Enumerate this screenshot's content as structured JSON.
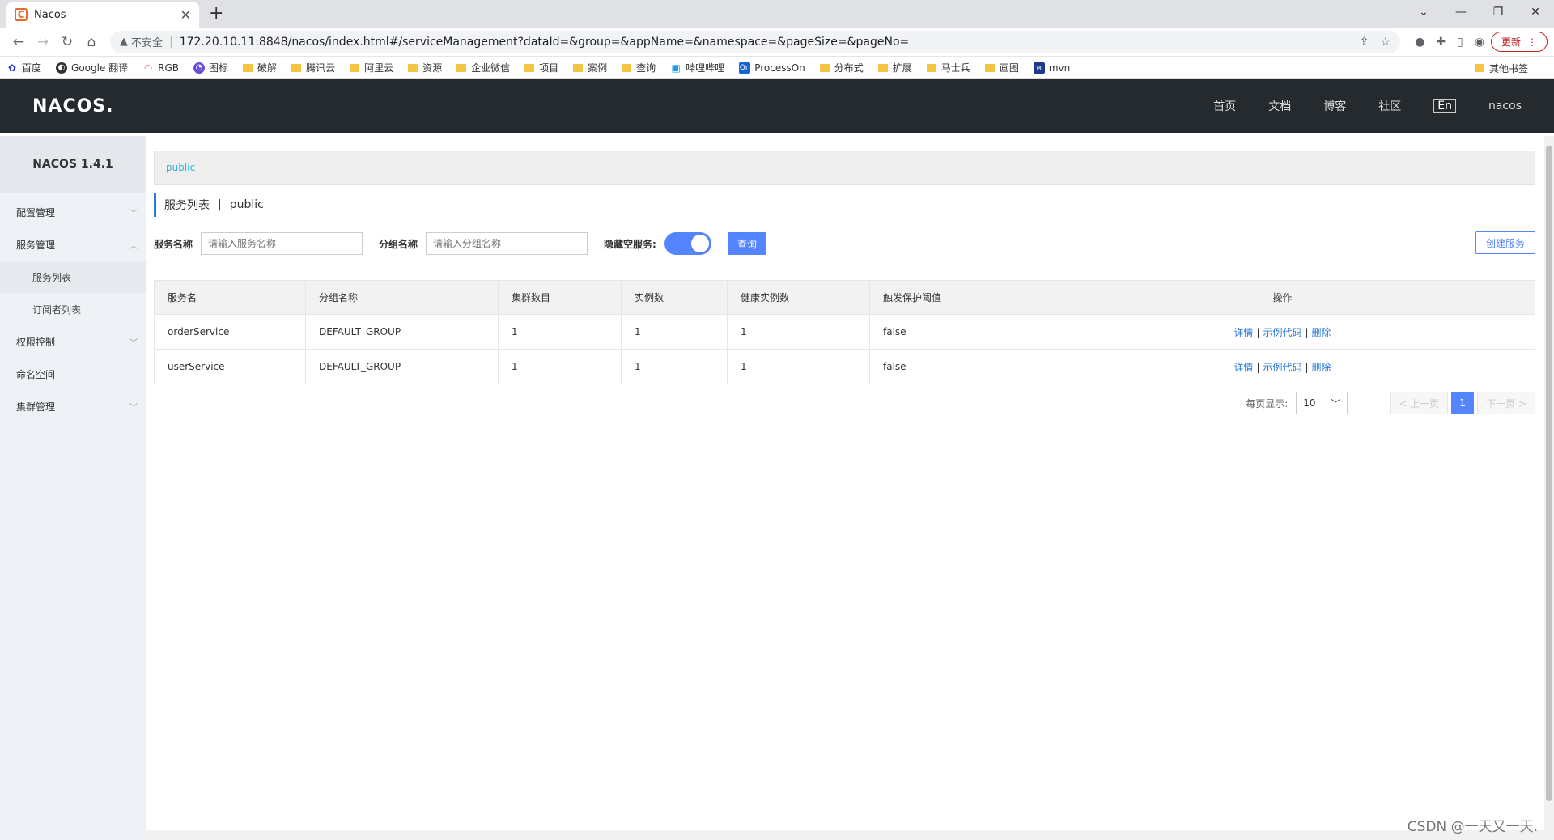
{
  "browser": {
    "tab_title": "Nacos",
    "insecure_label": "不安全",
    "url": "172.20.10.11:8848/nacos/index.html#/serviceManagement?dataId=&group=&appName=&namespace=&pageSize=&pageNo=",
    "update_label": "更新",
    "bookmarks": [
      "百度",
      "Google 翻译",
      "RGB",
      "图标",
      "破解",
      "腾讯云",
      "阿里云",
      "资源",
      "企业微信",
      "项目",
      "案例",
      "查询",
      "哔哩哔哩",
      "ProcessOn",
      "分布式",
      "扩展",
      "马士兵",
      "画图",
      "mvn"
    ],
    "other_bookmarks": "其他书签"
  },
  "header": {
    "logo": "NACOS.",
    "nav": [
      "首页",
      "文档",
      "博客",
      "社区"
    ],
    "lang": "En",
    "user": "nacos"
  },
  "sidebar": {
    "version": "NACOS 1.4.1",
    "items": {
      "config": "配置管理",
      "service": "服务管理",
      "service_list": "服务列表",
      "subscriber_list": "订阅者列表",
      "auth": "权限控制",
      "namespace": "命名空间",
      "cluster": "集群管理"
    }
  },
  "content": {
    "namespace": "public",
    "title": "服务列表",
    "title_sep": "|",
    "title_ns": "public",
    "filter": {
      "service_label": "服务名称",
      "service_placeholder": "请输入服务名称",
      "group_label": "分组名称",
      "group_placeholder": "请输入分组名称",
      "hide_empty_label": "隐藏空服务:",
      "hide_empty_on": true,
      "query_button": "查询",
      "create_button": "创建服务"
    },
    "table": {
      "headers": [
        "服务名",
        "分组名称",
        "集群数目",
        "实例数",
        "健康实例数",
        "触发保护阈值",
        "操作"
      ],
      "rows": [
        [
          "orderService",
          "DEFAULT_GROUP",
          "1",
          "1",
          "1",
          "false"
        ],
        [
          "userService",
          "DEFAULT_GROUP",
          "1",
          "1",
          "1",
          "false"
        ]
      ],
      "ops": [
        "详情",
        "示例代码",
        "删除"
      ],
      "op_sep": "|"
    },
    "pager": {
      "per_page_label": "每页显示:",
      "page_size": "10",
      "prev": "< 上一页",
      "current": "1",
      "next": "下一页 >"
    }
  },
  "watermark": "CSDN @一天又一天."
}
